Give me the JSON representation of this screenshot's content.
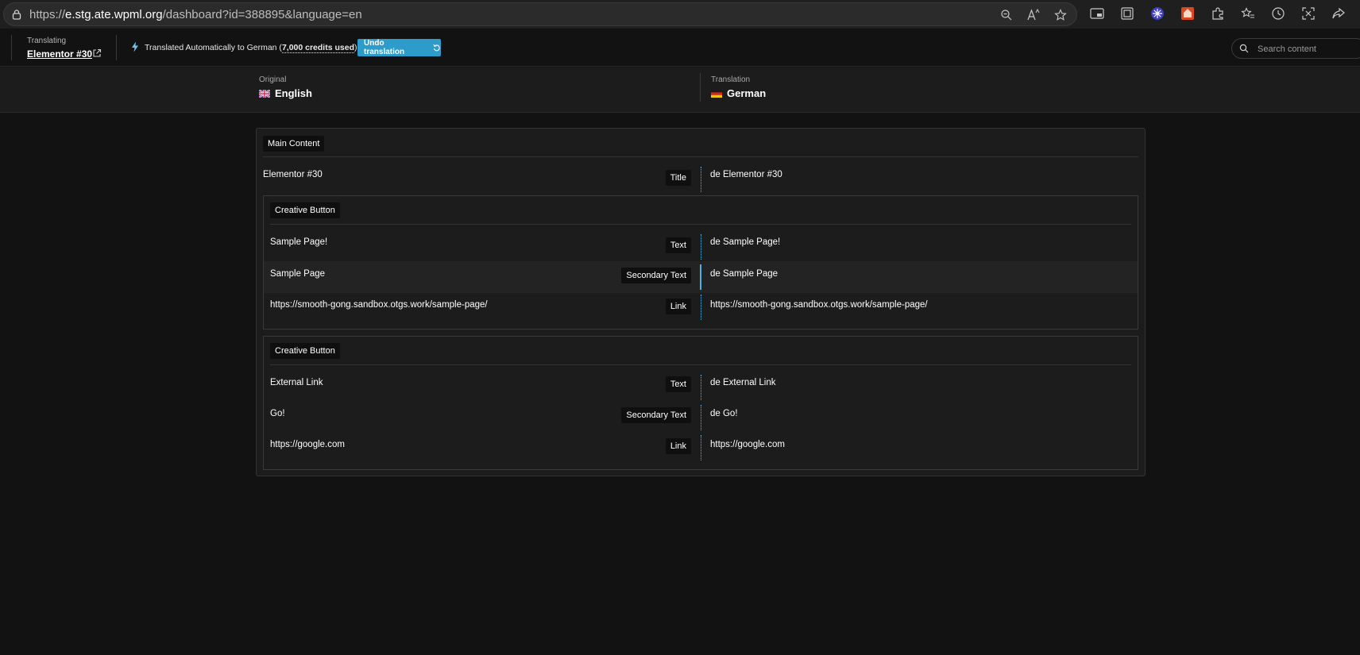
{
  "browser": {
    "url_scheme": "https://",
    "url_host": "e.stg.ate.wpml.org",
    "url_path": "/dashboard?id=388895&language=en"
  },
  "header": {
    "translating_label": "Translating",
    "doc_title": "Elementor #30",
    "auto_text_prefix": "Translated Automatically to German (",
    "credits": "7,000 credits used",
    "auto_text_suffix": ")",
    "undo_label": "Undo translation",
    "search_placeholder": "Search content"
  },
  "languages": {
    "original_label": "Original",
    "original_name": "English",
    "translation_label": "Translation",
    "translation_name": "German"
  },
  "content": {
    "section_title": "Main Content",
    "title_row": {
      "source": "Elementor #30",
      "field": "Title",
      "target": "de Elementor #30"
    },
    "groups": [
      {
        "title": "Creative Button",
        "rows": [
          {
            "source": "Sample Page!",
            "field": "Text",
            "target": "de Sample Page!"
          },
          {
            "source": "Sample Page",
            "field": "Secondary Text",
            "target": "de Sample Page"
          },
          {
            "source": "https://smooth-gong.sandbox.otgs.work/sample-page/",
            "field": "Link",
            "target": "https://smooth-gong.sandbox.otgs.work/sample-page/"
          }
        ]
      },
      {
        "title": "Creative Button",
        "rows": [
          {
            "source": "External Link",
            "field": "Text",
            "target": "de External Link"
          },
          {
            "source": "Go!",
            "field": "Secondary Text",
            "target": "de Go!"
          },
          {
            "source": "https://google.com",
            "field": "Link",
            "target": "https://google.com"
          }
        ]
      }
    ]
  }
}
